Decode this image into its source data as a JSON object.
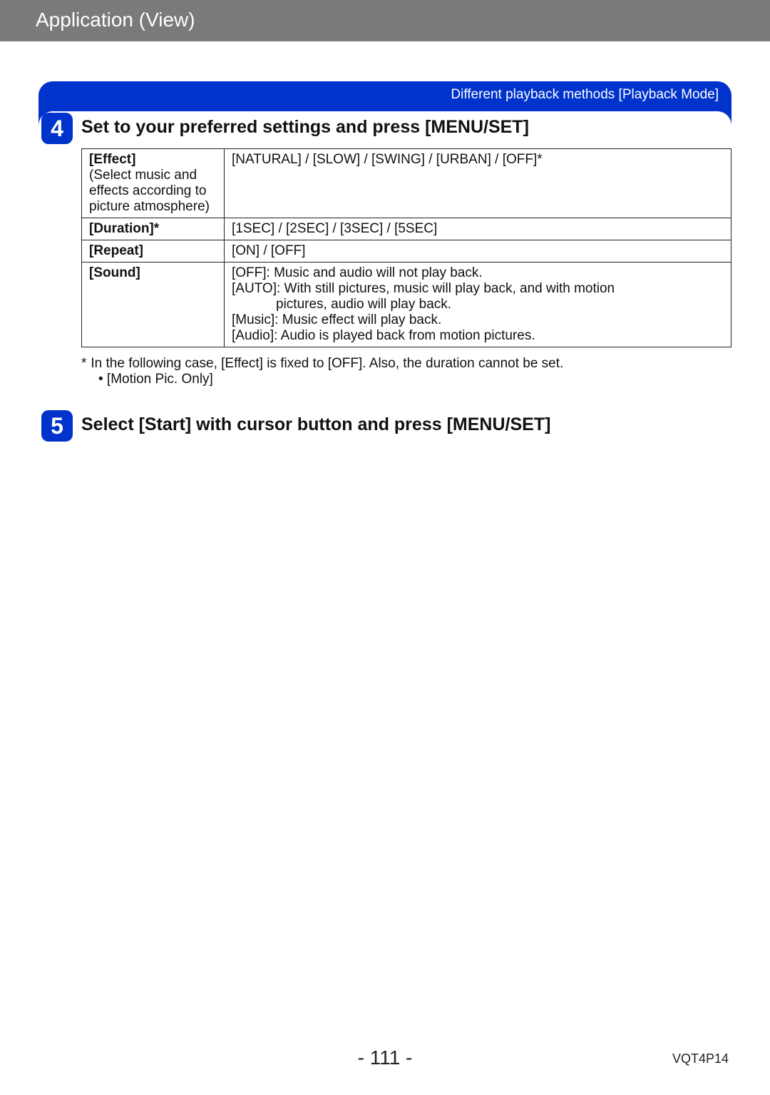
{
  "header": {
    "title": "Application (View)"
  },
  "banner": {
    "text": "Different playback methods  [Playback Mode]"
  },
  "step4": {
    "number": "4",
    "title": "Set to your preferred settings and press [MENU/SET]",
    "rows": [
      {
        "label_bold": "[Effect]",
        "label_desc": "(Select music and effects according to picture atmosphere)",
        "value": "[NATURAL] / [SLOW] / [SWING] / [URBAN] / [OFF]*"
      },
      {
        "label_bold": "[Duration]*",
        "label_desc": "",
        "value": "[1SEC] / [2SEC] / [3SEC] / [5SEC]"
      },
      {
        "label_bold": "[Repeat]",
        "label_desc": "",
        "value": "[ON] / [OFF]"
      },
      {
        "label_bold": "[Sound]",
        "label_desc": "",
        "value_lines": [
          "[OFF]: Music and audio will not play back.",
          "[AUTO]: With still pictures, music will play back, and with motion",
          "pictures, audio will play back.",
          "[Music]: Music effect will play back.",
          "[Audio]: Audio is played back from motion pictures."
        ]
      }
    ],
    "note": {
      "star": "*",
      "line1": "In the following case, [Effect] is fixed to [OFF]. Also, the duration cannot be set.",
      "bullet": "• [Motion Pic. Only]"
    }
  },
  "step5": {
    "number": "5",
    "title": "Select [Start] with cursor button and press [MENU/SET]"
  },
  "footer": {
    "page": "- 111 -",
    "code": "VQT4P14"
  }
}
